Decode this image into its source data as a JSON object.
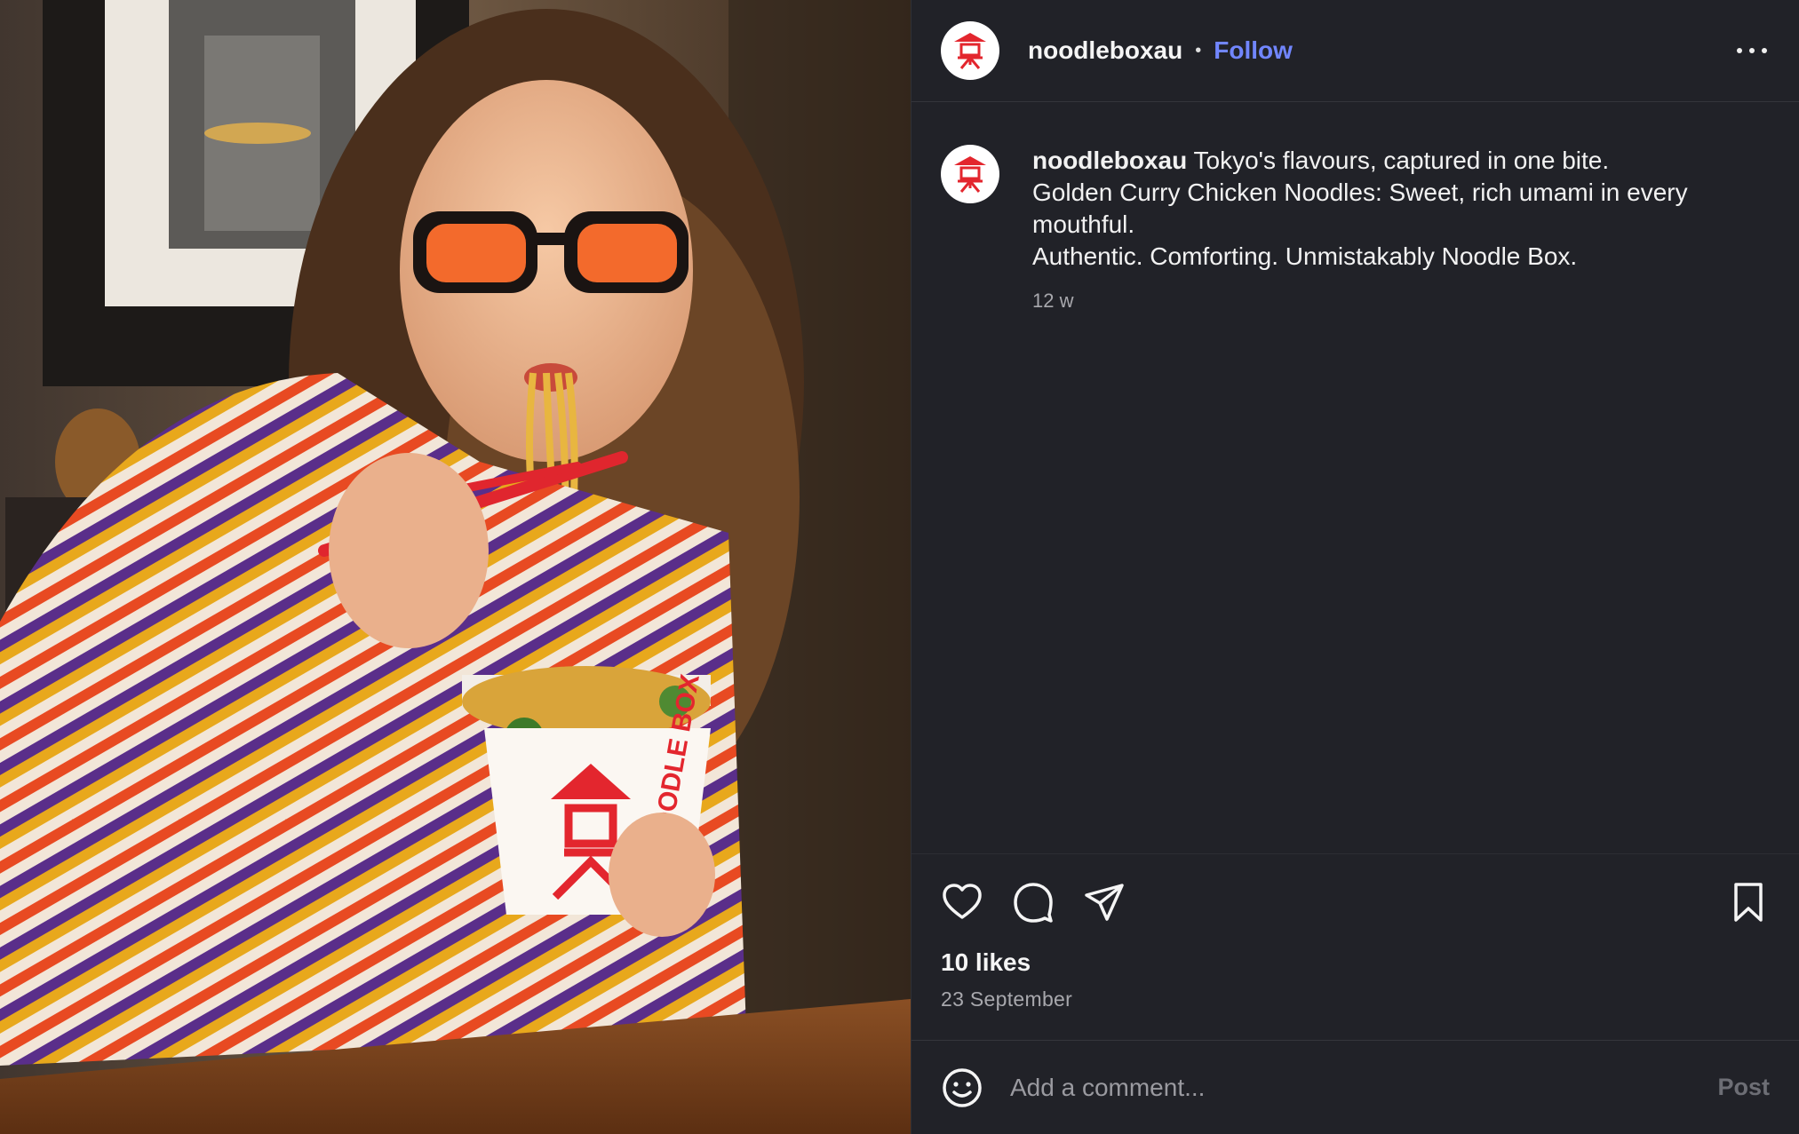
{
  "post": {
    "username": "noodleboxau",
    "follow_label": "Follow",
    "separator": "•",
    "caption": {
      "username": "noodleboxau",
      "line1": "Tokyo's flavours, captured in one bite.",
      "line2": "Golden Curry Chicken Noodles: Sweet, rich umami in every mouthful.",
      "line3": "Authentic. Comforting. Unmistakably Noodle Box.",
      "time": "12 w"
    },
    "likes": "10 likes",
    "date": "23 September"
  },
  "photo": {
    "box_brand_text": "NOODLE BOX"
  },
  "comment": {
    "placeholder": "Add a comment...",
    "post_label": "Post"
  },
  "colors": {
    "brand_red": "#e3262e",
    "follow_blue": "#7186ff",
    "panel_bg": "#212228"
  },
  "icons": [
    "more-options-icon",
    "heart-icon",
    "comment-icon",
    "share-icon",
    "bookmark-icon",
    "emoji-icon"
  ]
}
